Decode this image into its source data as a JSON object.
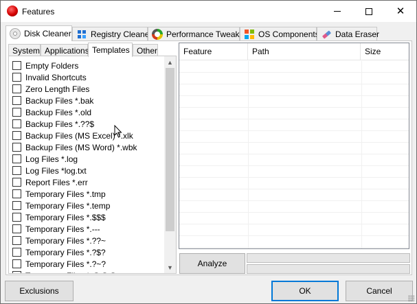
{
  "window": {
    "title": "Features"
  },
  "main_tabs": [
    {
      "label": "Disk Cleaner",
      "icon": "disc-icon",
      "active": true
    },
    {
      "label": "Registry Cleaner",
      "icon": "registry-icon"
    },
    {
      "label": "Performance Tweaks",
      "icon": "gauge-icon"
    },
    {
      "label": "OS Components",
      "icon": "windows-icon"
    },
    {
      "label": "Data Eraser",
      "icon": "eraser-icon"
    }
  ],
  "sub_tabs": [
    {
      "label": "System"
    },
    {
      "label": "Applications"
    },
    {
      "label": "Templates",
      "active": true
    },
    {
      "label": "Other"
    }
  ],
  "templates": [
    "Empty Folders",
    "Invalid Shortcuts",
    "Zero Length Files",
    "Backup Files *.bak",
    "Backup Files *.old",
    "Backup Files *.??$",
    "Backup Files (MS Excel) *.xlk",
    "Backup Files (MS Word) *.wbk",
    "Log Files *.log",
    "Log Files *log.txt",
    "Report Files *.err",
    "Temporary Files *.tmp",
    "Temporary Files *.temp",
    "Temporary Files *.$$$",
    "Temporary Files *.---",
    "Temporary Files *.??~",
    "Temporary Files *.?$?",
    "Temporary Files *.?~?",
    "Temporary Files *.@@@"
  ],
  "results": {
    "columns": [
      "Feature",
      "Path",
      "Size"
    ]
  },
  "buttons": {
    "analyze": "Analyze",
    "exclusions": "Exclusions",
    "ok": "OK",
    "cancel": "Cancel"
  }
}
